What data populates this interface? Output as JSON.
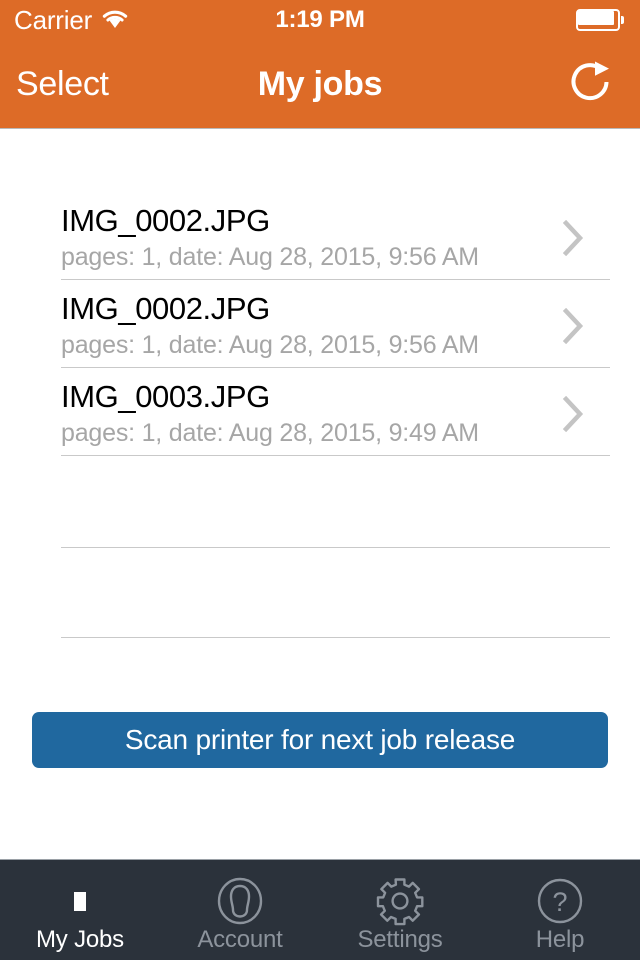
{
  "statusbar": {
    "carrier": "Carrier",
    "wifi_icon": "wifi-icon",
    "time": "1:19 PM",
    "battery_icon": "battery-icon"
  },
  "navbar": {
    "left_button": "Select",
    "title": "My jobs",
    "refresh_icon": "refresh-icon"
  },
  "colors": {
    "header_orange": "#DD6B27",
    "button_blue": "#20689F",
    "tabbar_dark": "#2B323B",
    "tab_inactive": "#8C939C",
    "tab_active": "#FFFFFF",
    "subtitle_gray": "#A6A6A6",
    "separator_gray": "#C9C9C9"
  },
  "jobs": [
    {
      "name": "IMG_0002.JPG",
      "meta": "pages: 1, date: Aug 28, 2015, 9:56 AM"
    },
    {
      "name": "IMG_0002.JPG",
      "meta": "pages: 1, date: Aug 28, 2015, 9:56 AM"
    },
    {
      "name": "IMG_0003.JPG",
      "meta": "pages: 1, date: Aug 28, 2015, 9:49 AM"
    }
  ],
  "empty_rows": 2,
  "scan_button": {
    "label": "Scan printer for next job release"
  },
  "tabbar": {
    "items": [
      {
        "label": "My Jobs",
        "icon": "list-stack-icon",
        "active": true
      },
      {
        "label": "Account",
        "icon": "person-circle-icon",
        "active": false
      },
      {
        "label": "Settings",
        "icon": "gear-icon",
        "active": false
      },
      {
        "label": "Help",
        "icon": "question-circle-icon",
        "active": false
      }
    ]
  }
}
